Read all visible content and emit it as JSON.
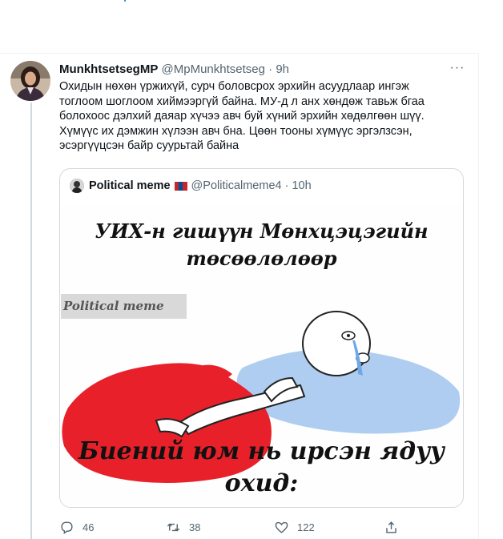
{
  "tweet": {
    "author_name": "MunkhtsetsegMP",
    "handle": "@MpMunkhtsetseg",
    "separator": "·",
    "time": "9h",
    "more_label": "···",
    "text_lines": [
      "Охидын нөхөн үржихүй, сурч боловсрох эрхийн асуудлаар ингэж",
      "тоглоом шоглоом хиймээргүй байна. МУ-д л анх хөндөж тавьж бгаа",
      "болохоос дэлхий даяар хүчээ авч буй хүний эрхийн хөдөлгөөн шүү.",
      "Хүмүүс их дэмжин хүлээн авч бна. Цөөн тооны хүмүүс эргэлзсэн,",
      "эсэргүүцсэн байр суурьтай байна"
    ]
  },
  "quote": {
    "author_name": "Political meme",
    "handle": "@Politicalmeme4",
    "separator": "·",
    "time": "10h",
    "flag_colors": [
      "#c4272f",
      "#015197",
      "#c4272f"
    ],
    "meme": {
      "title_line1": "УИХ-н гишүүн Мөнхцэцэгийн",
      "title_line2": "төсөөлөлөөр",
      "watermark": "Political meme",
      "bottom_line1": "Биений юм нь ирсэн ядуу",
      "bottom_line2": "охид:"
    }
  },
  "actions": {
    "replies": "46",
    "retweets": "38",
    "likes": "122"
  },
  "colors": {
    "text": "#0f1419",
    "secondary": "#536471",
    "border": "#cfd9de",
    "blood": "#e8202a",
    "puddle": "#aecdf0"
  }
}
